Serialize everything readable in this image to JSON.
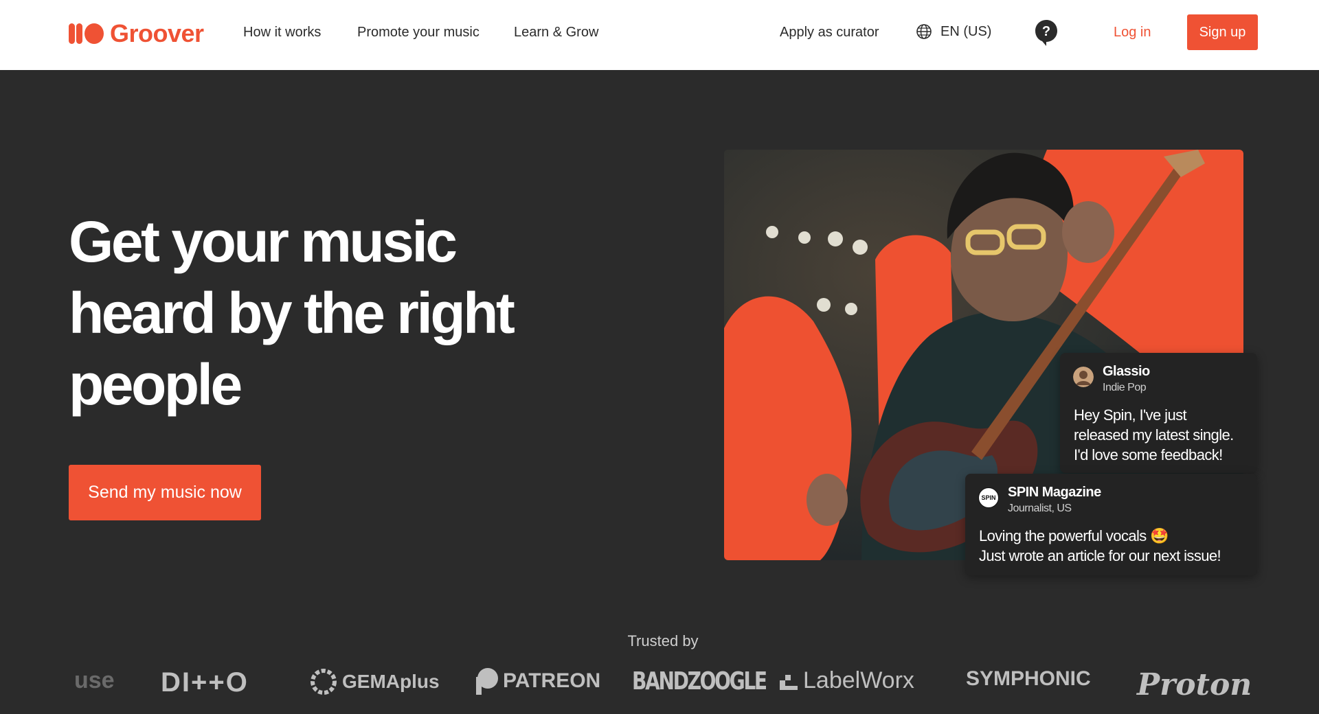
{
  "header": {
    "logo_text": "Groover",
    "nav": [
      "How it works",
      "Promote your music",
      "Learn & Grow"
    ],
    "apply_curator": "Apply as curator",
    "language": "EN (US)",
    "help_glyph": "?",
    "login": "Log in",
    "signup": "Sign up"
  },
  "hero": {
    "title": "Get your music heard by the right people",
    "cta": "Send my music now"
  },
  "bubbles": [
    {
      "name": "Glassio",
      "sub": "Indie Pop",
      "message": "Hey Spin, I've just\nreleased my latest single.\nI'd love some feedback!"
    },
    {
      "name": "SPIN Magazine",
      "sub": "Journalist, US",
      "avatar_text": "SPIN",
      "message": "Loving the powerful vocals 🤩\nJust wrote an article for our next issue!"
    }
  ],
  "trusted": {
    "label": "Trusted by",
    "partners": [
      "use",
      "DI++O",
      "GEMAplus",
      "PATREON",
      "BANDZOOGLE",
      "LabelWorx",
      "SYMPHONIC",
      "Proton"
    ]
  },
  "colors": {
    "brand": "#ef5234",
    "background": "#2b2b2b",
    "header_bg": "#ffffff"
  },
  "icons": [
    "groover-logo-icon",
    "globe-icon",
    "help-icon",
    "patreon-icon",
    "gema-icon",
    "labelworx-icon"
  ]
}
